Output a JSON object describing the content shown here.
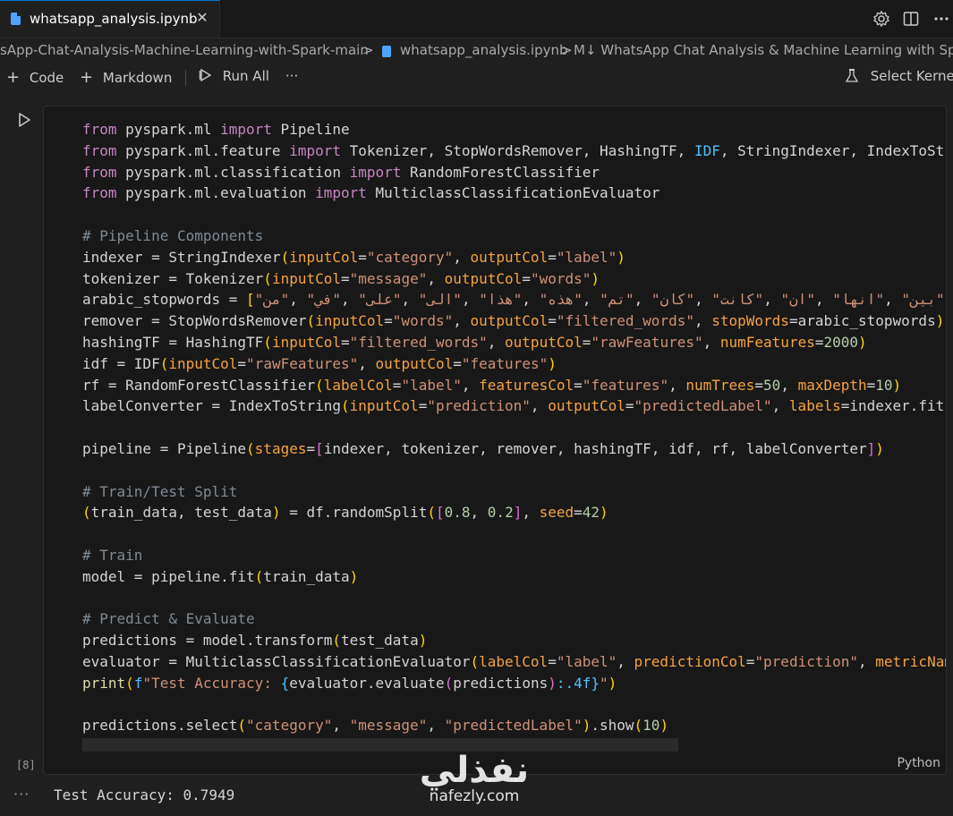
{
  "tab": {
    "title": "whatsapp_analysis.ipynb",
    "close": "✕"
  },
  "breadcrumb": {
    "folder": "sApp-Chat-Analysis-Machine-Learning-with-Spark-main",
    "file": "whatsapp_analysis.ipynb",
    "section": "M↓ WhatsApp Chat Analysis & Machine Learning with Spark",
    "sep": ">"
  },
  "toolbar": {
    "code_label": "Code",
    "markdown_label": "Markdown",
    "run_all_label": "Run All",
    "more_label": "···",
    "select_kernel_label": "Select Kernel"
  },
  "cell": {
    "execution_count": "[8]",
    "language": "Python",
    "lines": [
      [
        [
          "kw",
          "from"
        ],
        [
          "plain",
          " pyspark.ml "
        ],
        [
          "kw",
          "import"
        ],
        [
          "plain",
          " Pipeline"
        ]
      ],
      [
        [
          "kw",
          "from"
        ],
        [
          "plain",
          " pyspark.ml.feature "
        ],
        [
          "kw",
          "import"
        ],
        [
          "plain",
          " Tokenizer, StopWordsRemover, HashingTF, "
        ],
        [
          "blue",
          "IDF"
        ],
        [
          "plain",
          ", StringIndexer, IndexToString"
        ]
      ],
      [
        [
          "kw",
          "from"
        ],
        [
          "plain",
          " pyspark.ml.classification "
        ],
        [
          "kw",
          "import"
        ],
        [
          "plain",
          " RandomForestClassifier"
        ]
      ],
      [
        [
          "kw",
          "from"
        ],
        [
          "plain",
          " pyspark.ml.evaluation "
        ],
        [
          "kw",
          "import"
        ],
        [
          "plain",
          " MulticlassClassificationEvaluator"
        ]
      ],
      [],
      [
        [
          "cmt",
          "# Pipeline Components"
        ]
      ],
      [
        [
          "plain",
          "indexer = StringIndexer"
        ],
        [
          "bk1",
          "("
        ],
        [
          "prm",
          "inputCol"
        ],
        [
          "plain",
          "="
        ],
        [
          "str",
          "\"category\""
        ],
        [
          "plain",
          ", "
        ],
        [
          "prm",
          "outputCol"
        ],
        [
          "plain",
          "="
        ],
        [
          "str",
          "\"label\""
        ],
        [
          "bk1",
          ")"
        ]
      ],
      [
        [
          "plain",
          "tokenizer = Tokenizer"
        ],
        [
          "bk1",
          "("
        ],
        [
          "prm",
          "inputCol"
        ],
        [
          "plain",
          "="
        ],
        [
          "str",
          "\"message\""
        ],
        [
          "plain",
          ", "
        ],
        [
          "prm",
          "outputCol"
        ],
        [
          "plain",
          "="
        ],
        [
          "str",
          "\"words\""
        ],
        [
          "bk1",
          ")"
        ]
      ],
      [
        [
          "plain",
          "arabic_stopwords = "
        ],
        [
          "bk1",
          "["
        ],
        [
          "str",
          "\"من\""
        ],
        [
          "plain",
          ", "
        ],
        [
          "str",
          "\"في\""
        ],
        [
          "plain",
          ", "
        ],
        [
          "str",
          "\"على\""
        ],
        [
          "plain",
          ", "
        ],
        [
          "str",
          "\"الى\""
        ],
        [
          "plain",
          ", "
        ],
        [
          "str",
          "\"هذا\""
        ],
        [
          "plain",
          ", "
        ],
        [
          "str",
          "\"هذه\""
        ],
        [
          "plain",
          ", "
        ],
        [
          "str",
          "\"تم\""
        ],
        [
          "plain",
          ", "
        ],
        [
          "str",
          "\"كان\""
        ],
        [
          "plain",
          ", "
        ],
        [
          "str",
          "\"كانت\""
        ],
        [
          "plain",
          ", "
        ],
        [
          "str",
          "\"ان\""
        ],
        [
          "plain",
          ", "
        ],
        [
          "str",
          "\"انها\""
        ],
        [
          "plain",
          ", "
        ],
        [
          "str",
          "\"بين\""
        ]
      ],
      [
        [
          "plain",
          "remover = StopWordsRemover"
        ],
        [
          "bk1",
          "("
        ],
        [
          "prm",
          "inputCol"
        ],
        [
          "plain",
          "="
        ],
        [
          "str",
          "\"words\""
        ],
        [
          "plain",
          ", "
        ],
        [
          "prm",
          "outputCol"
        ],
        [
          "plain",
          "="
        ],
        [
          "str",
          "\"filtered_words\""
        ],
        [
          "plain",
          ", "
        ],
        [
          "prm",
          "stopWords"
        ],
        [
          "plain",
          "=arabic_stopwords"
        ],
        [
          "bk1",
          ")"
        ]
      ],
      [
        [
          "plain",
          "hashingTF = HashingTF"
        ],
        [
          "bk1",
          "("
        ],
        [
          "prm",
          "inputCol"
        ],
        [
          "plain",
          "="
        ],
        [
          "str",
          "\"filtered_words\""
        ],
        [
          "plain",
          ", "
        ],
        [
          "prm",
          "outputCol"
        ],
        [
          "plain",
          "="
        ],
        [
          "str",
          "\"rawFeatures\""
        ],
        [
          "plain",
          ", "
        ],
        [
          "prm",
          "numFeatures"
        ],
        [
          "plain",
          "="
        ],
        [
          "num",
          "2000"
        ],
        [
          "bk1",
          ")"
        ]
      ],
      [
        [
          "plain",
          "idf = IDF"
        ],
        [
          "bk1",
          "("
        ],
        [
          "prm",
          "inputCol"
        ],
        [
          "plain",
          "="
        ],
        [
          "str",
          "\"rawFeatures\""
        ],
        [
          "plain",
          ", "
        ],
        [
          "prm",
          "outputCol"
        ],
        [
          "plain",
          "="
        ],
        [
          "str",
          "\"features\""
        ],
        [
          "bk1",
          ")"
        ]
      ],
      [
        [
          "plain",
          "rf = RandomForestClassifier"
        ],
        [
          "bk1",
          "("
        ],
        [
          "prm",
          "labelCol"
        ],
        [
          "plain",
          "="
        ],
        [
          "str",
          "\"label\""
        ],
        [
          "plain",
          ", "
        ],
        [
          "prm",
          "featuresCol"
        ],
        [
          "plain",
          "="
        ],
        [
          "str",
          "\"features\""
        ],
        [
          "plain",
          ", "
        ],
        [
          "prm",
          "numTrees"
        ],
        [
          "plain",
          "="
        ],
        [
          "num",
          "50"
        ],
        [
          "plain",
          ", "
        ],
        [
          "prm",
          "maxDepth"
        ],
        [
          "plain",
          "="
        ],
        [
          "num",
          "10"
        ],
        [
          "bk1",
          ")"
        ]
      ],
      [
        [
          "plain",
          "labelConverter = IndexToString"
        ],
        [
          "bk1",
          "("
        ],
        [
          "prm",
          "inputCol"
        ],
        [
          "plain",
          "="
        ],
        [
          "str",
          "\"prediction\""
        ],
        [
          "plain",
          ", "
        ],
        [
          "prm",
          "outputCol"
        ],
        [
          "plain",
          "="
        ],
        [
          "str",
          "\"predictedLabel\""
        ],
        [
          "plain",
          ", "
        ],
        [
          "prm",
          "labels"
        ],
        [
          "plain",
          "=indexer.fit"
        ],
        [
          "bk2",
          "("
        ]
      ],
      [],
      [
        [
          "plain",
          "pipeline = Pipeline"
        ],
        [
          "bk1",
          "("
        ],
        [
          "prm",
          "stages"
        ],
        [
          "plain",
          "="
        ],
        [
          "bk2",
          "["
        ],
        [
          "plain",
          "indexer, tokenizer, remover, hashingTF, idf, rf, labelConverter"
        ],
        [
          "bk2",
          "]"
        ],
        [
          "bk1",
          ")"
        ]
      ],
      [],
      [
        [
          "cmt",
          "# Train/Test Split"
        ]
      ],
      [
        [
          "bk1",
          "("
        ],
        [
          "plain",
          "train_data, test_data"
        ],
        [
          "bk1",
          ")"
        ],
        [
          "plain",
          " = df.randomSplit"
        ],
        [
          "bk1",
          "("
        ],
        [
          "bk2",
          "["
        ],
        [
          "num",
          "0.8"
        ],
        [
          "plain",
          ", "
        ],
        [
          "num",
          "0.2"
        ],
        [
          "bk2",
          "]"
        ],
        [
          "plain",
          ", "
        ],
        [
          "prm",
          "seed"
        ],
        [
          "plain",
          "="
        ],
        [
          "num",
          "42"
        ],
        [
          "bk1",
          ")"
        ]
      ],
      [],
      [
        [
          "cmt",
          "# Train"
        ]
      ],
      [
        [
          "plain",
          "model = pipeline.fit"
        ],
        [
          "bk1",
          "("
        ],
        [
          "plain",
          "train_data"
        ],
        [
          "bk1",
          ")"
        ]
      ],
      [],
      [
        [
          "cmt",
          "# Predict & Evaluate"
        ]
      ],
      [
        [
          "plain",
          "predictions = model.transform"
        ],
        [
          "bk1",
          "("
        ],
        [
          "plain",
          "test_data"
        ],
        [
          "bk1",
          ")"
        ]
      ],
      [
        [
          "plain",
          "evaluator = MulticlassClassificationEvaluator"
        ],
        [
          "bk1",
          "("
        ],
        [
          "prm",
          "labelCol"
        ],
        [
          "plain",
          "="
        ],
        [
          "str",
          "\"label\""
        ],
        [
          "plain",
          ", "
        ],
        [
          "prm",
          "predictionCol"
        ],
        [
          "plain",
          "="
        ],
        [
          "str",
          "\"prediction\""
        ],
        [
          "plain",
          ", "
        ],
        [
          "prm",
          "metricName"
        ]
      ],
      [
        [
          "fn",
          "print"
        ],
        [
          "bk1",
          "("
        ],
        [
          "blue",
          "f"
        ],
        [
          "str",
          "\"Test Accuracy: "
        ],
        [
          "blue",
          "{"
        ],
        [
          "plain",
          "evaluator.evaluate"
        ],
        [
          "bk2",
          "("
        ],
        [
          "plain",
          "predictions"
        ],
        [
          "bk2",
          ")"
        ],
        [
          "blue",
          ":.4f}"
        ],
        [
          "str",
          "\""
        ],
        [
          "bk1",
          ")"
        ]
      ],
      [],
      [
        [
          "plain",
          "predictions.select"
        ],
        [
          "bk1",
          "("
        ],
        [
          "str",
          "\"category\""
        ],
        [
          "plain",
          ", "
        ],
        [
          "str",
          "\"message\""
        ],
        [
          "plain",
          ", "
        ],
        [
          "str",
          "\"predictedLabel\""
        ],
        [
          "bk1",
          ")"
        ],
        [
          "plain",
          ".show"
        ],
        [
          "bk1",
          "("
        ],
        [
          "num",
          "10"
        ],
        [
          "bk1",
          ")"
        ]
      ]
    ]
  },
  "output": {
    "more": "···",
    "text": "Test Accuracy: 0.7949"
  },
  "watermark": {
    "arabic": "نفذلي",
    "latin": "nafezly.com"
  }
}
